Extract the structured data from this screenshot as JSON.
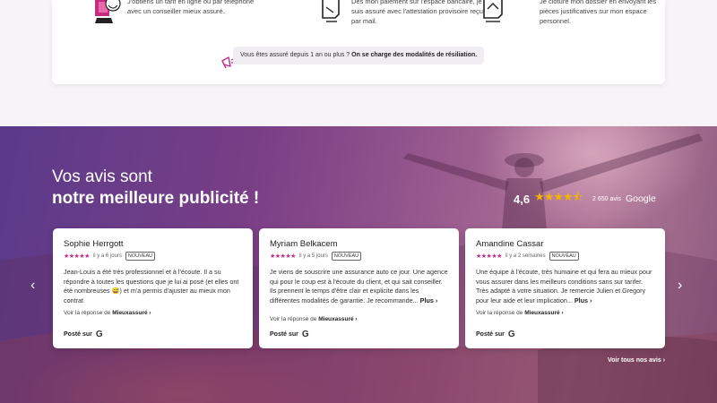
{
  "steps": [
    {
      "text": "J'obtiens un tarif en ligne ou par téléphone avec un conseiller mieux assuré.",
      "icon": "person-illustration"
    },
    {
      "text": "Dès mon paiement sur l'espace bancaire, je suis assuré avec l'attestation provisoire reçu par mail.",
      "icon": "document-phone-icon"
    },
    {
      "text": "Je clôture mon dossier en envoyant les pièces justificatives sur mon espace personnel.",
      "icon": "document-upload-icon"
    }
  ],
  "notice": {
    "text": "Vous êtes assuré depuis 1 an ou plus ? ",
    "bold": "On se charge des modalités de résiliation."
  },
  "hero": {
    "title_line1": "Vos avis sont",
    "title_line2": "notre meilleure publicité !"
  },
  "rating": {
    "score": "4,6",
    "stars": "★★★★⯪",
    "count": "2 650 avis",
    "provider": "Google"
  },
  "reviews": [
    {
      "name": "Sophie Herrgott",
      "stars": "★★★★★",
      "time": "il y a 6 jours",
      "badge": "NOUVEAU",
      "body": "Jean-Louis a été très professionnel et à l'écoute. Il a su répondre à toutes les questions que je lui ai posé (et elles ont été nombreuses 😅) et m'a permis d'ajuster au mieux mon contrat",
      "more": "",
      "reply_prefix": "Voir la réponse de",
      "reply_name": "Mieuxassuré ›",
      "posted": "Posté sur",
      "posted_icon": "G"
    },
    {
      "name": "Myriam Belkacem",
      "stars": "★★★★★",
      "time": "il y a 5 jours",
      "badge": "NOUVEAU",
      "body": "Je viens de souscrire une assurance auto ce jour. Une agence qui pour le coup est à l'écoute du client, et qui sait conseiller. Ils prennent le temps d'être clair et explicite dans les différentes modalités de garantie. Je recommande... ",
      "more": "Plus ›",
      "reply_prefix": "Voir la réponse de",
      "reply_name": "Mieuxassuré ›",
      "posted": "Posté sur",
      "posted_icon": "G"
    },
    {
      "name": "Amandine Cassar",
      "stars": "★★★★★",
      "time": "il y a 2 semaines",
      "badge": "NOUVEAU",
      "body": "Une équipe à l'écoute, très humaine et qui fera au mieux pour vous assurer dans les meilleurs conditions sans sur tarifer. Très adapté à votre situation. Je remercie Julien et Gregory pour leur aide et leur implication... ",
      "more": "Plus ›",
      "reply_prefix": "Voir la réponse de",
      "reply_name": "Mieuxassuré ›",
      "posted": "Posté sur",
      "posted_icon": "G"
    }
  ],
  "nav": {
    "prev": "‹",
    "next": "›"
  },
  "all_reviews": "Voir tous nos avis ›",
  "colors": {
    "accent": "#c42c84",
    "star": "#f5b301"
  }
}
